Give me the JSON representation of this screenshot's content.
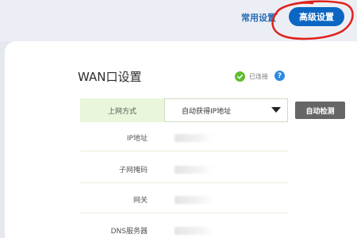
{
  "header": {
    "common_settings": "常用设置",
    "advanced_settings": "高级设置"
  },
  "wan": {
    "title": "WAN口设置",
    "status": "已连接",
    "help": "?"
  },
  "connection": {
    "label": "上网方式",
    "selected": "自动获得IP地址",
    "detect_button": "自动检测"
  },
  "fields": [
    {
      "label": "IP地址",
      "value": ""
    },
    {
      "label": "子网掩码",
      "value": ""
    },
    {
      "label": "网关",
      "value": ""
    },
    {
      "label": "DNS服务器",
      "value": ""
    }
  ],
  "colors": {
    "accent": "#0b66c3",
    "connected": "#5fbe2f",
    "annotation": "#e0201b"
  }
}
